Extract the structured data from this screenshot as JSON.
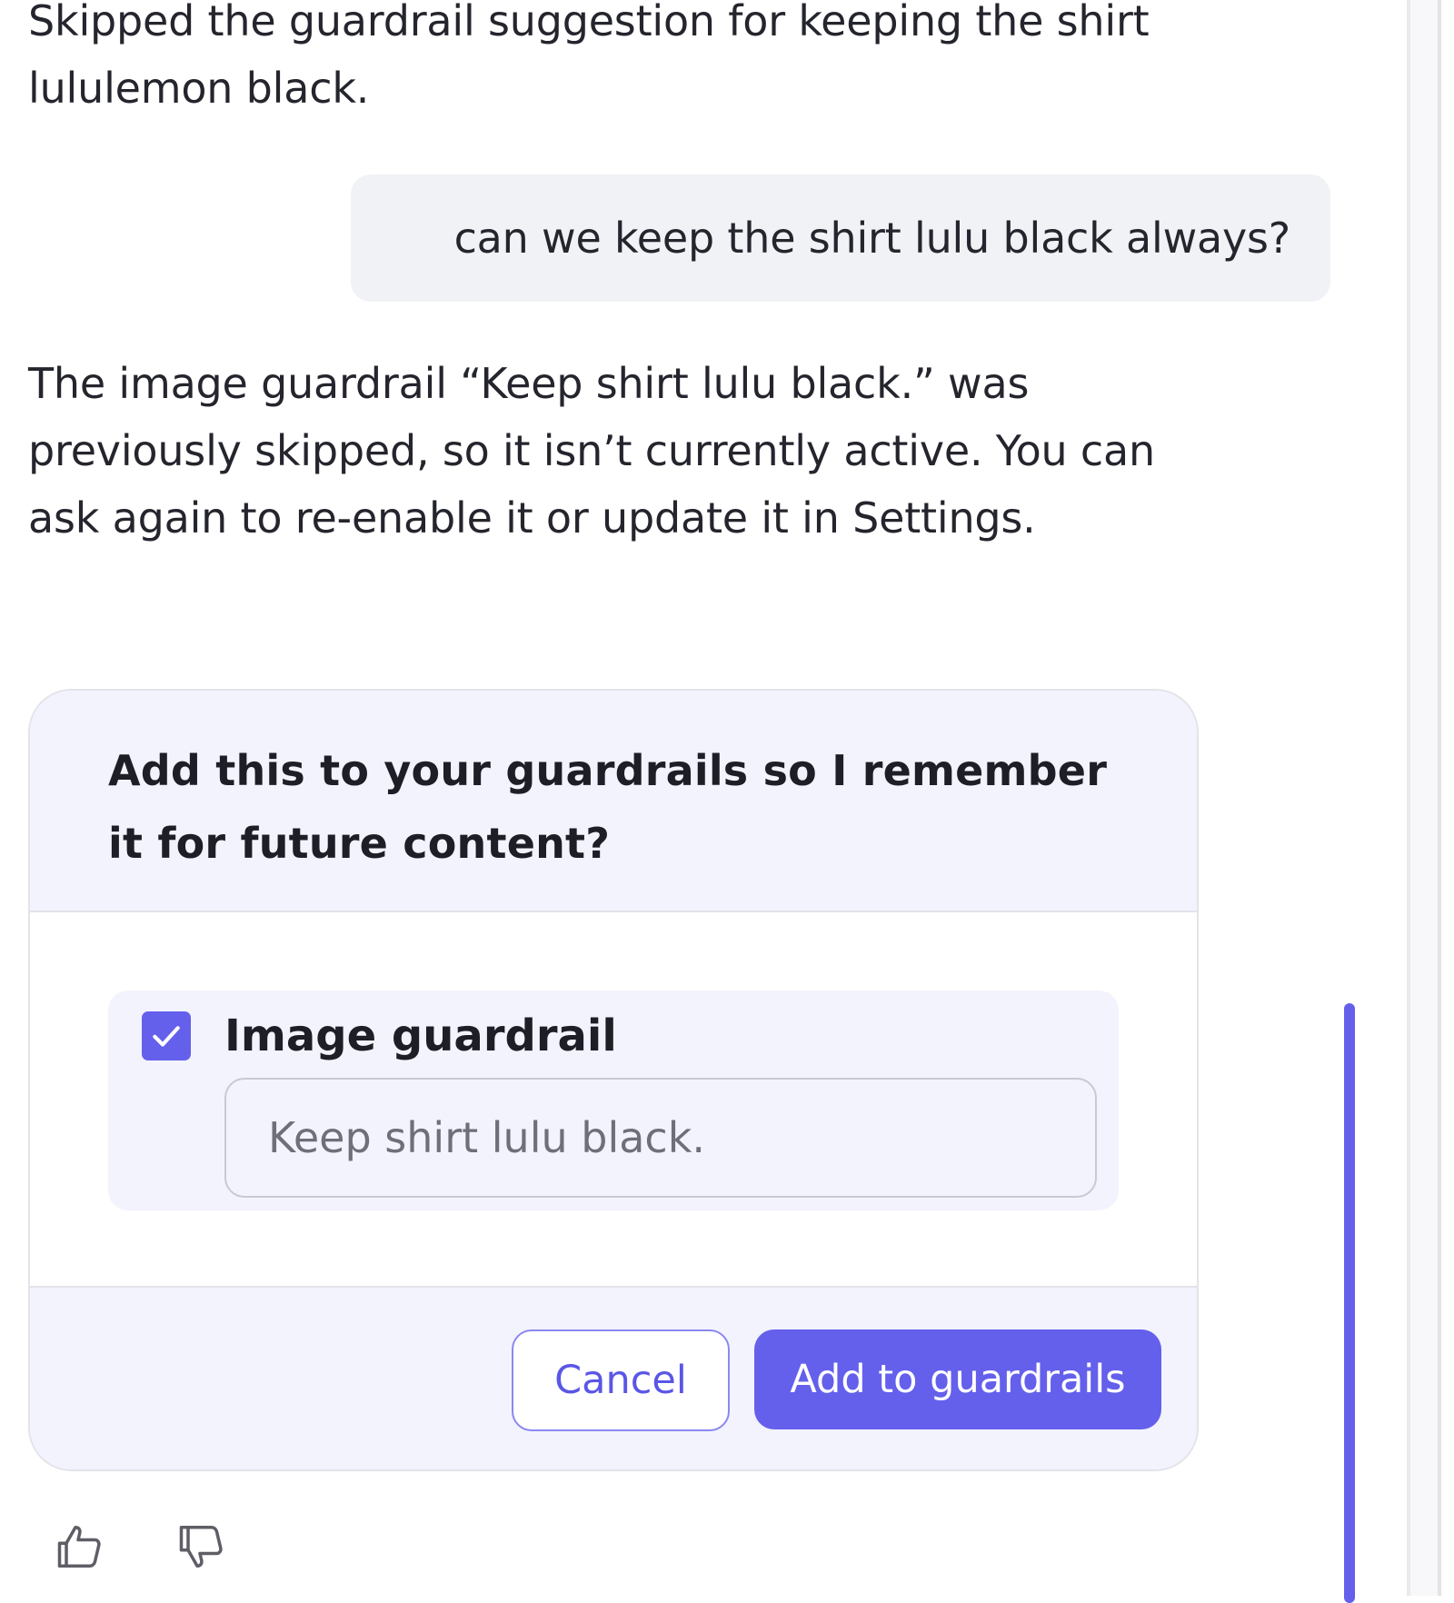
{
  "messages": {
    "assistant_prev": "Skipped the guardrail suggestion for keeping the shirt lululemon black.",
    "user": "can we keep the shirt lulu black always?",
    "assistant_reply": "The image guardrail “Keep shirt lulu black.” was previously skipped, so it isn’t currently active. You can ask again to re-enable it or update it in Settings."
  },
  "guardrail_card": {
    "question": "Add this to your guardrails so I remember it for future content?",
    "option": {
      "label": "Image guardrail",
      "checked": true,
      "placeholder": "Keep shirt lulu black."
    },
    "cancel_label": "Cancel",
    "confirm_label": "Add to guardrails"
  },
  "feedback": {
    "like_icon": "thumbs-up-icon",
    "dislike_icon": "thumbs-down-icon"
  },
  "colors": {
    "accent": "#6460ec",
    "card_tint": "#f3f3fd",
    "bubble": "#f1f2f6"
  }
}
